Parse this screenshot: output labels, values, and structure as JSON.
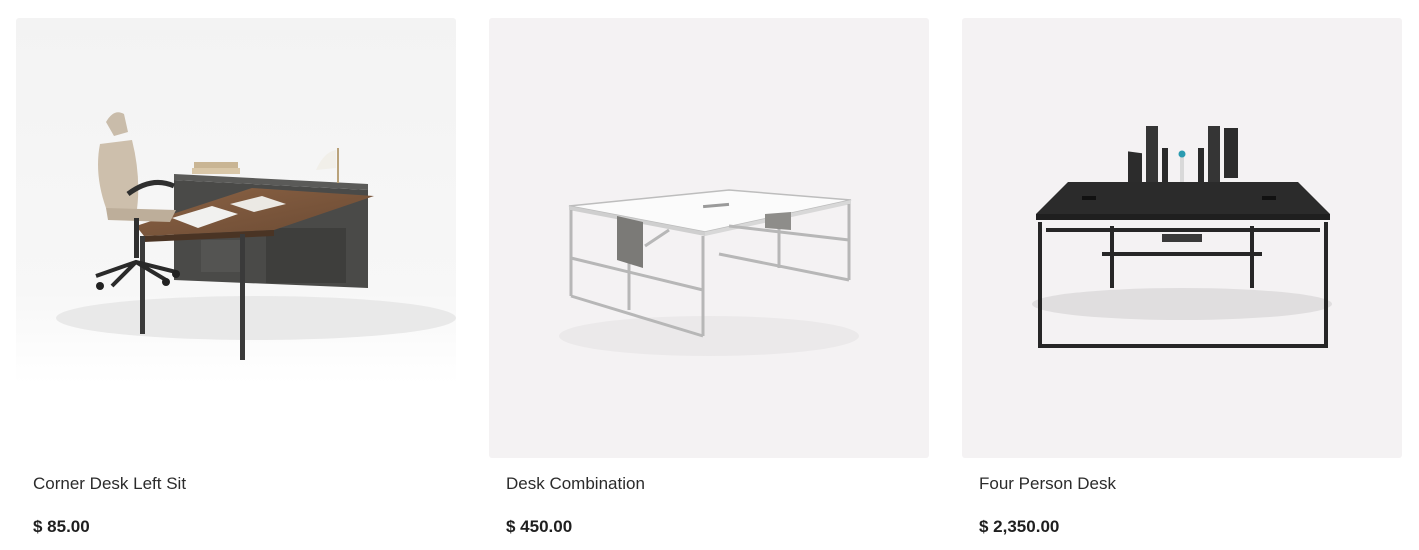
{
  "products": [
    {
      "title": "Corner Desk Left Sit",
      "price": "$ 85.00",
      "image": "corner-desk-photo"
    },
    {
      "title": "Desk Combination",
      "price": "$ 450.00",
      "image": "white-frame-desk-photo"
    },
    {
      "title": "Four Person Desk",
      "price": "$ 2,350.00",
      "image": "black-bench-desk-photo"
    }
  ]
}
